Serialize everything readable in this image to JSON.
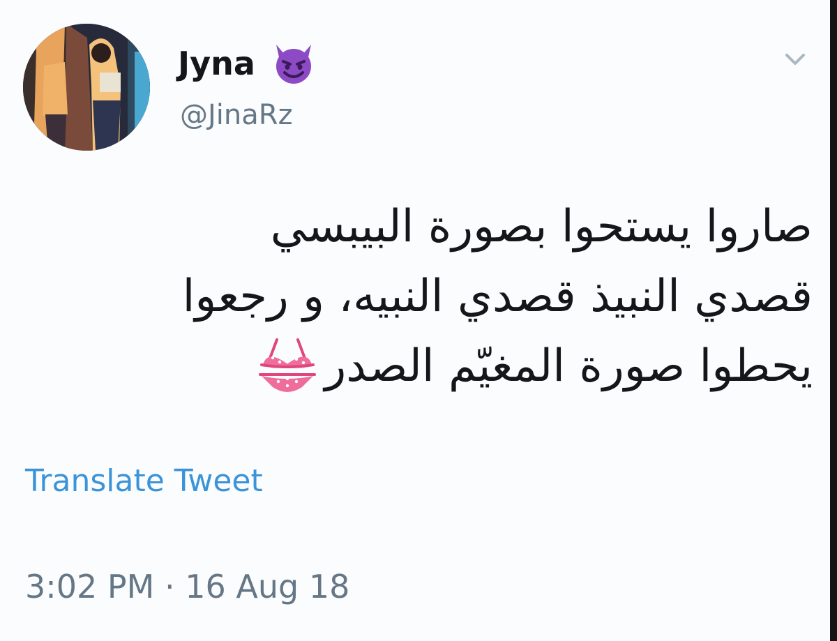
{
  "tweet": {
    "author": {
      "display_name": "Jyna",
      "handle": "@JinaRz",
      "name_emoji": "smiling-face-with-horns-icon"
    },
    "text_lines": [
      "صاروا يستحوا بصورة البيبسي",
      "قصدي النبيذ قصدي النبيه، و رجعوا",
      "يحطوا صورة المغيّم الصدر"
    ],
    "text_emoji": "bikini-icon",
    "translate_label": "Translate Tweet",
    "timestamp": "3:02 PM · 16 Aug 18"
  },
  "colors": {
    "text": "#14171a",
    "secondary": "#657786",
    "link": "#3b94d9",
    "background": "#fbfcfd"
  }
}
